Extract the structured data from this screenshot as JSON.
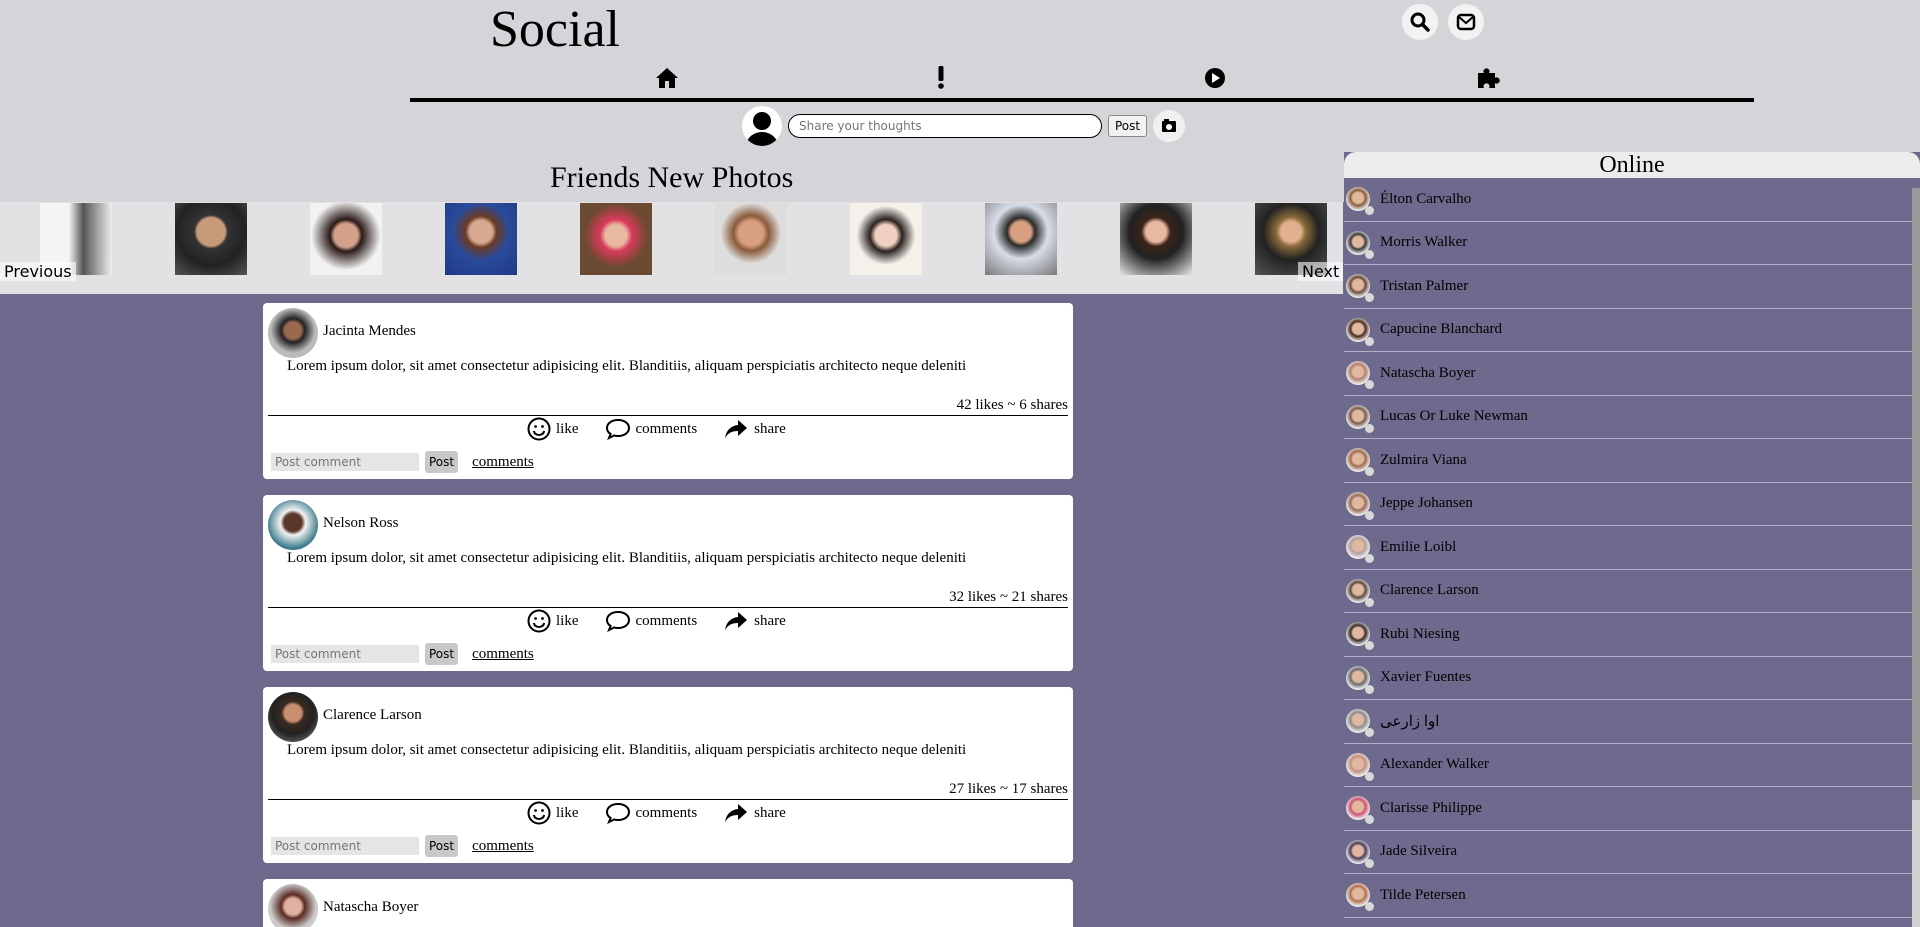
{
  "header": {
    "brand": "Social",
    "icons": [
      "search-icon",
      "mail-icon"
    ],
    "nav": [
      "home-icon",
      "alert-icon",
      "play-icon",
      "puzzle-icon"
    ]
  },
  "composer": {
    "placeholder": "Share your thoughts",
    "post_label": "Post"
  },
  "photos": {
    "title": "Friends New Photos",
    "prev_label": "Previous",
    "next_label": "Next",
    "count": 10
  },
  "posts": [
    {
      "author": "Jacinta Mendes",
      "text": "Lorem ipsum dolor, sit amet consectetur adipisicing elit. Blanditiis, aliquam perspiciatis architecto neque deleniti",
      "stats": "42 likes ~ 6 shares"
    },
    {
      "author": "Nelson Ross",
      "text": "Lorem ipsum dolor, sit amet consectetur adipisicing elit. Blanditiis, aliquam perspiciatis architecto neque deleniti",
      "stats": "32 likes ~ 21 shares"
    },
    {
      "author": "Clarence Larson",
      "text": "Lorem ipsum dolor, sit amet consectetur adipisicing elit. Blanditiis, aliquam perspiciatis architecto neque deleniti",
      "stats": "27 likes ~ 17 shares"
    },
    {
      "author": "Natascha Boyer",
      "text": "",
      "stats": ""
    }
  ],
  "post_actions": {
    "like": "like",
    "comments": "comments",
    "share": "share"
  },
  "comment": {
    "placeholder": "Post comment",
    "post_label": "Post",
    "link": "comments"
  },
  "online": {
    "title": "Online",
    "users": [
      "Élton Carvalho",
      "Morris Walker",
      "Tristan Palmer",
      "Capucine Blanchard",
      "Natascha Boyer",
      "Lucas Or Luke Newman",
      "Zulmira Viana",
      "Jeppe Johansen",
      "Emilie Loibl",
      "Clarence Larson",
      "Rubi Niesing",
      "Xavier Fuentes",
      "اوا زارعی",
      "Alexander Walker",
      "Clarisse Philippe",
      "Jade Silveira",
      "Tilde Petersen"
    ]
  }
}
